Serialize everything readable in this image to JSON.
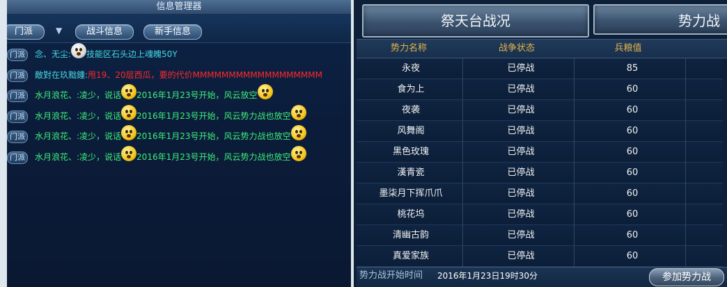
{
  "left_panel": {
    "title": "信息管理器",
    "tabs": {
      "channel": "门派",
      "arrow": "▼",
      "battle": "战斗信息",
      "newbie": "新手信息"
    },
    "messages": [
      {
        "badge": "门派",
        "parts": [
          {
            "t": "念、无尘:",
            "c": "cyan"
          },
          {
            "emoji": "white"
          },
          {
            "t": "技能区石头边上魂魄50Y",
            "c": "cyan"
          }
        ]
      },
      {
        "badge": "门派",
        "parts": [
          {
            "t": "敵對在玖黜鍾:",
            "c": "cyan"
          },
          {
            "t": "甩19、20层西瓜，要的代价MMMMMMMMMMMMMMMMMM",
            "c": "red"
          }
        ]
      },
      {
        "badge": "门派",
        "parts": [
          {
            "t": "水月浪花、:凌少，说话",
            "c": "green"
          },
          {
            "emoji": "yellow"
          },
          {
            "t": "2016年1月23号开始，风云放空",
            "c": "green"
          },
          {
            "emoji": "yellow"
          }
        ]
      },
      {
        "badge": "门派",
        "parts": [
          {
            "t": "水月浪花、:凌少，说话",
            "c": "green"
          },
          {
            "emoji": "yellow"
          },
          {
            "t": "2016年1月23号开始，风云势力战也放空",
            "c": "green"
          },
          {
            "emoji": "yellow"
          }
        ]
      },
      {
        "badge": "门派",
        "parts": [
          {
            "t": "水月浪花、:凌少，说话",
            "c": "green"
          },
          {
            "emoji": "yellow"
          },
          {
            "t": "2016年1月23号开始，风云势力战也放空",
            "c": "green"
          },
          {
            "emoji": "yellow"
          }
        ]
      },
      {
        "badge": "门派",
        "parts": [
          {
            "t": "水月浪花、:凌少，说话",
            "c": "green"
          },
          {
            "emoji": "yellow"
          },
          {
            "t": "2016年1月23号开始，风云势力战也放空",
            "c": "green"
          },
          {
            "emoji": "yellow"
          }
        ]
      }
    ]
  },
  "right_panel": {
    "header_main": "祭天台战况",
    "header_second": "势力战",
    "columns": [
      "势力名称",
      "战争状态",
      "兵粮值"
    ],
    "rows": [
      [
        "永夜",
        "已停战",
        "85"
      ],
      [
        "食为上",
        "已停战",
        "60"
      ],
      [
        "夜袭",
        "已停战",
        "60"
      ],
      [
        "风舞阁",
        "已停战",
        "60"
      ],
      [
        "黑色玫瑰",
        "已停战",
        "60"
      ],
      [
        "漢青瓷",
        "已停战",
        "60"
      ],
      [
        "墨柒月下挥爪爪",
        "已停战",
        "60"
      ],
      [
        "桃花坞",
        "已停战",
        "60"
      ],
      [
        "清幽古韵",
        "已停战",
        "60"
      ],
      [
        "真爱家族",
        "已停战",
        "60"
      ]
    ],
    "footer_label": "势力战开始时间",
    "footer_time": "2016年1月23日19时30分",
    "join_button": "参加势力战"
  },
  "colors": {
    "cyan_text": "#45d7e3",
    "red_text": "#ff2a2a",
    "green_text": "#3ef07a",
    "header_gold": "#e1b54a"
  }
}
